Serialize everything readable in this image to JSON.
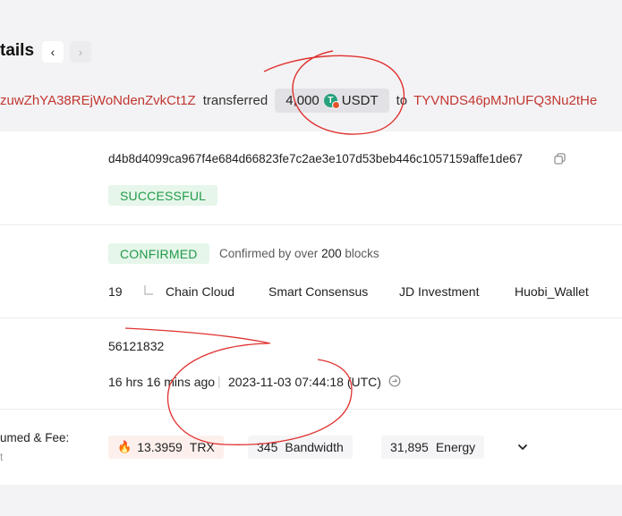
{
  "header": {
    "title_fragment": "tails",
    "nav_prev_glyph": "‹",
    "nav_next_glyph": "›"
  },
  "transfer": {
    "from_address": "zuwZhYA38REjWoNdenZvkCt1Z",
    "verb": "transferred",
    "amount": "4,000",
    "token_symbol": "USDT",
    "token_glyph": "T",
    "to_word": "to",
    "to_address": "TYVNDS46pMJnUFQ3Nu2tHe"
  },
  "hash_row": {
    "hash": "d4b8d4099ca967f4e684d66823fe7c2ae3e107d53beb446c1057159affe1de67",
    "result": "SUCCESSFUL"
  },
  "confirmation": {
    "status": "CONFIRMED",
    "note_prefix": "Confirmed by over",
    "blocks": "200",
    "note_suffix": "blocks",
    "sr_count": "19",
    "super_representatives": [
      "Chain Cloud",
      "Smart Consensus",
      "JD Investment",
      "Huobi_Wallet"
    ]
  },
  "block": {
    "height": "56121832",
    "age": "16 hrs 16 mins ago",
    "separator": "|",
    "timestamp": "2023-11-03 07:44:18",
    "timezone": "(UTC)"
  },
  "resources": {
    "label": "umed & Fee:",
    "label_line2": "t",
    "trx_amount": "13.3959",
    "trx_unit": "TRX",
    "bandwidth_amount": "345",
    "bandwidth_unit": "Bandwidth",
    "energy_amount": "31,895",
    "energy_unit": "Energy"
  },
  "colors": {
    "address": "#c23631",
    "success_bg": "#e6f6ea",
    "success_text": "#239a4a",
    "annotation": "#e0312f",
    "usdt": "#26a17b"
  },
  "icons": [
    "copy-icon",
    "tree-branch-icon",
    "clock-icon",
    "fire-icon",
    "chevron-down-icon",
    "usdt-token-icon"
  ]
}
